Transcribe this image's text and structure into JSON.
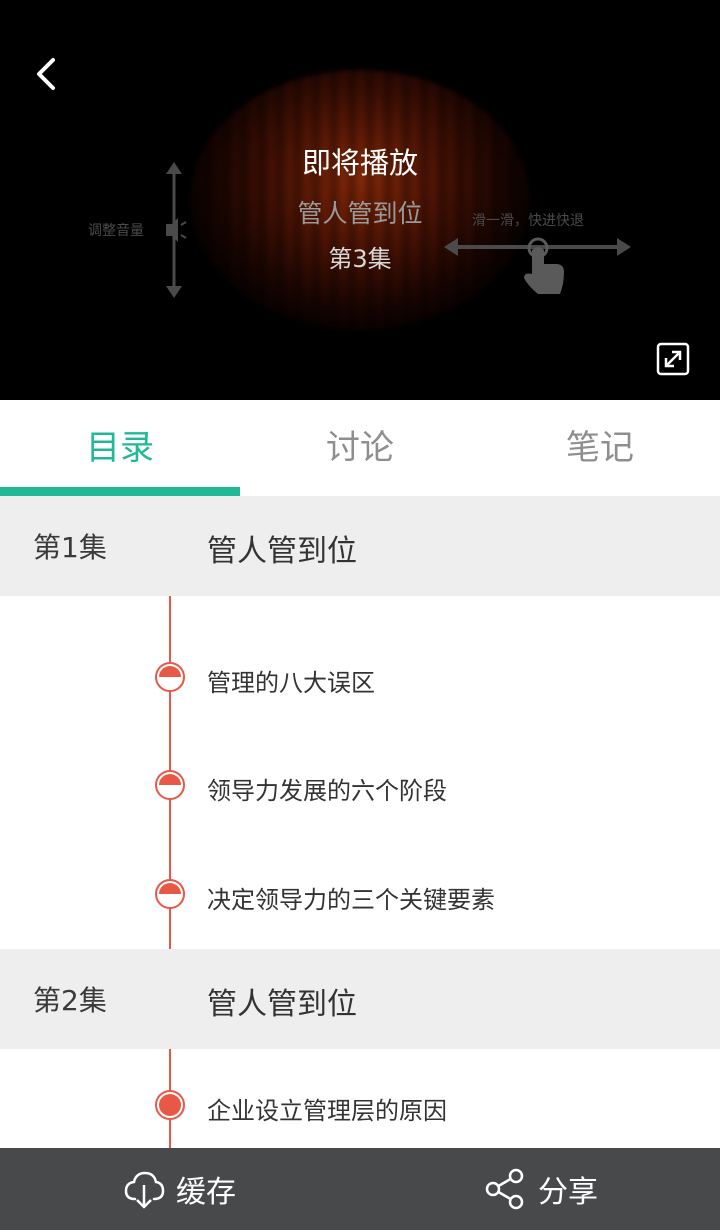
{
  "player": {
    "status": "即将播放",
    "course_title": "管人管到位",
    "episode_label": "第3集",
    "hint_volume": "调整音量",
    "hint_seek": "滑一滑，快进快退",
    "icons": {
      "back": "back-chevron-icon",
      "fullscreen": "fullscreen-icon",
      "volume": "speaker-icon",
      "seek": "hand-swipe-icon"
    }
  },
  "tabs": [
    {
      "label": "目录",
      "active": true
    },
    {
      "label": "讨论",
      "active": false
    },
    {
      "label": "笔记",
      "active": false
    }
  ],
  "colors": {
    "accent": "#1fb996",
    "timeline": "#e85846",
    "bottom_bar": "#48494b"
  },
  "episodes": [
    {
      "number": "第1集",
      "title": "管人管到位",
      "items": [
        {
          "label": "管理的八大误区",
          "progress": 0.5
        },
        {
          "label": "领导力发展的六个阶段",
          "progress": 0.5
        },
        {
          "label": "决定领导力的三个关键要素",
          "progress": 0.5
        }
      ]
    },
    {
      "number": "第2集",
      "title": "管人管到位",
      "items": [
        {
          "label": "企业设立管理层的原因",
          "progress": 1.0
        }
      ]
    }
  ],
  "bottom_bar": {
    "cache_label": "缓存",
    "share_label": "分享",
    "icons": {
      "cache": "cloud-download-icon",
      "share": "share-icon"
    }
  }
}
